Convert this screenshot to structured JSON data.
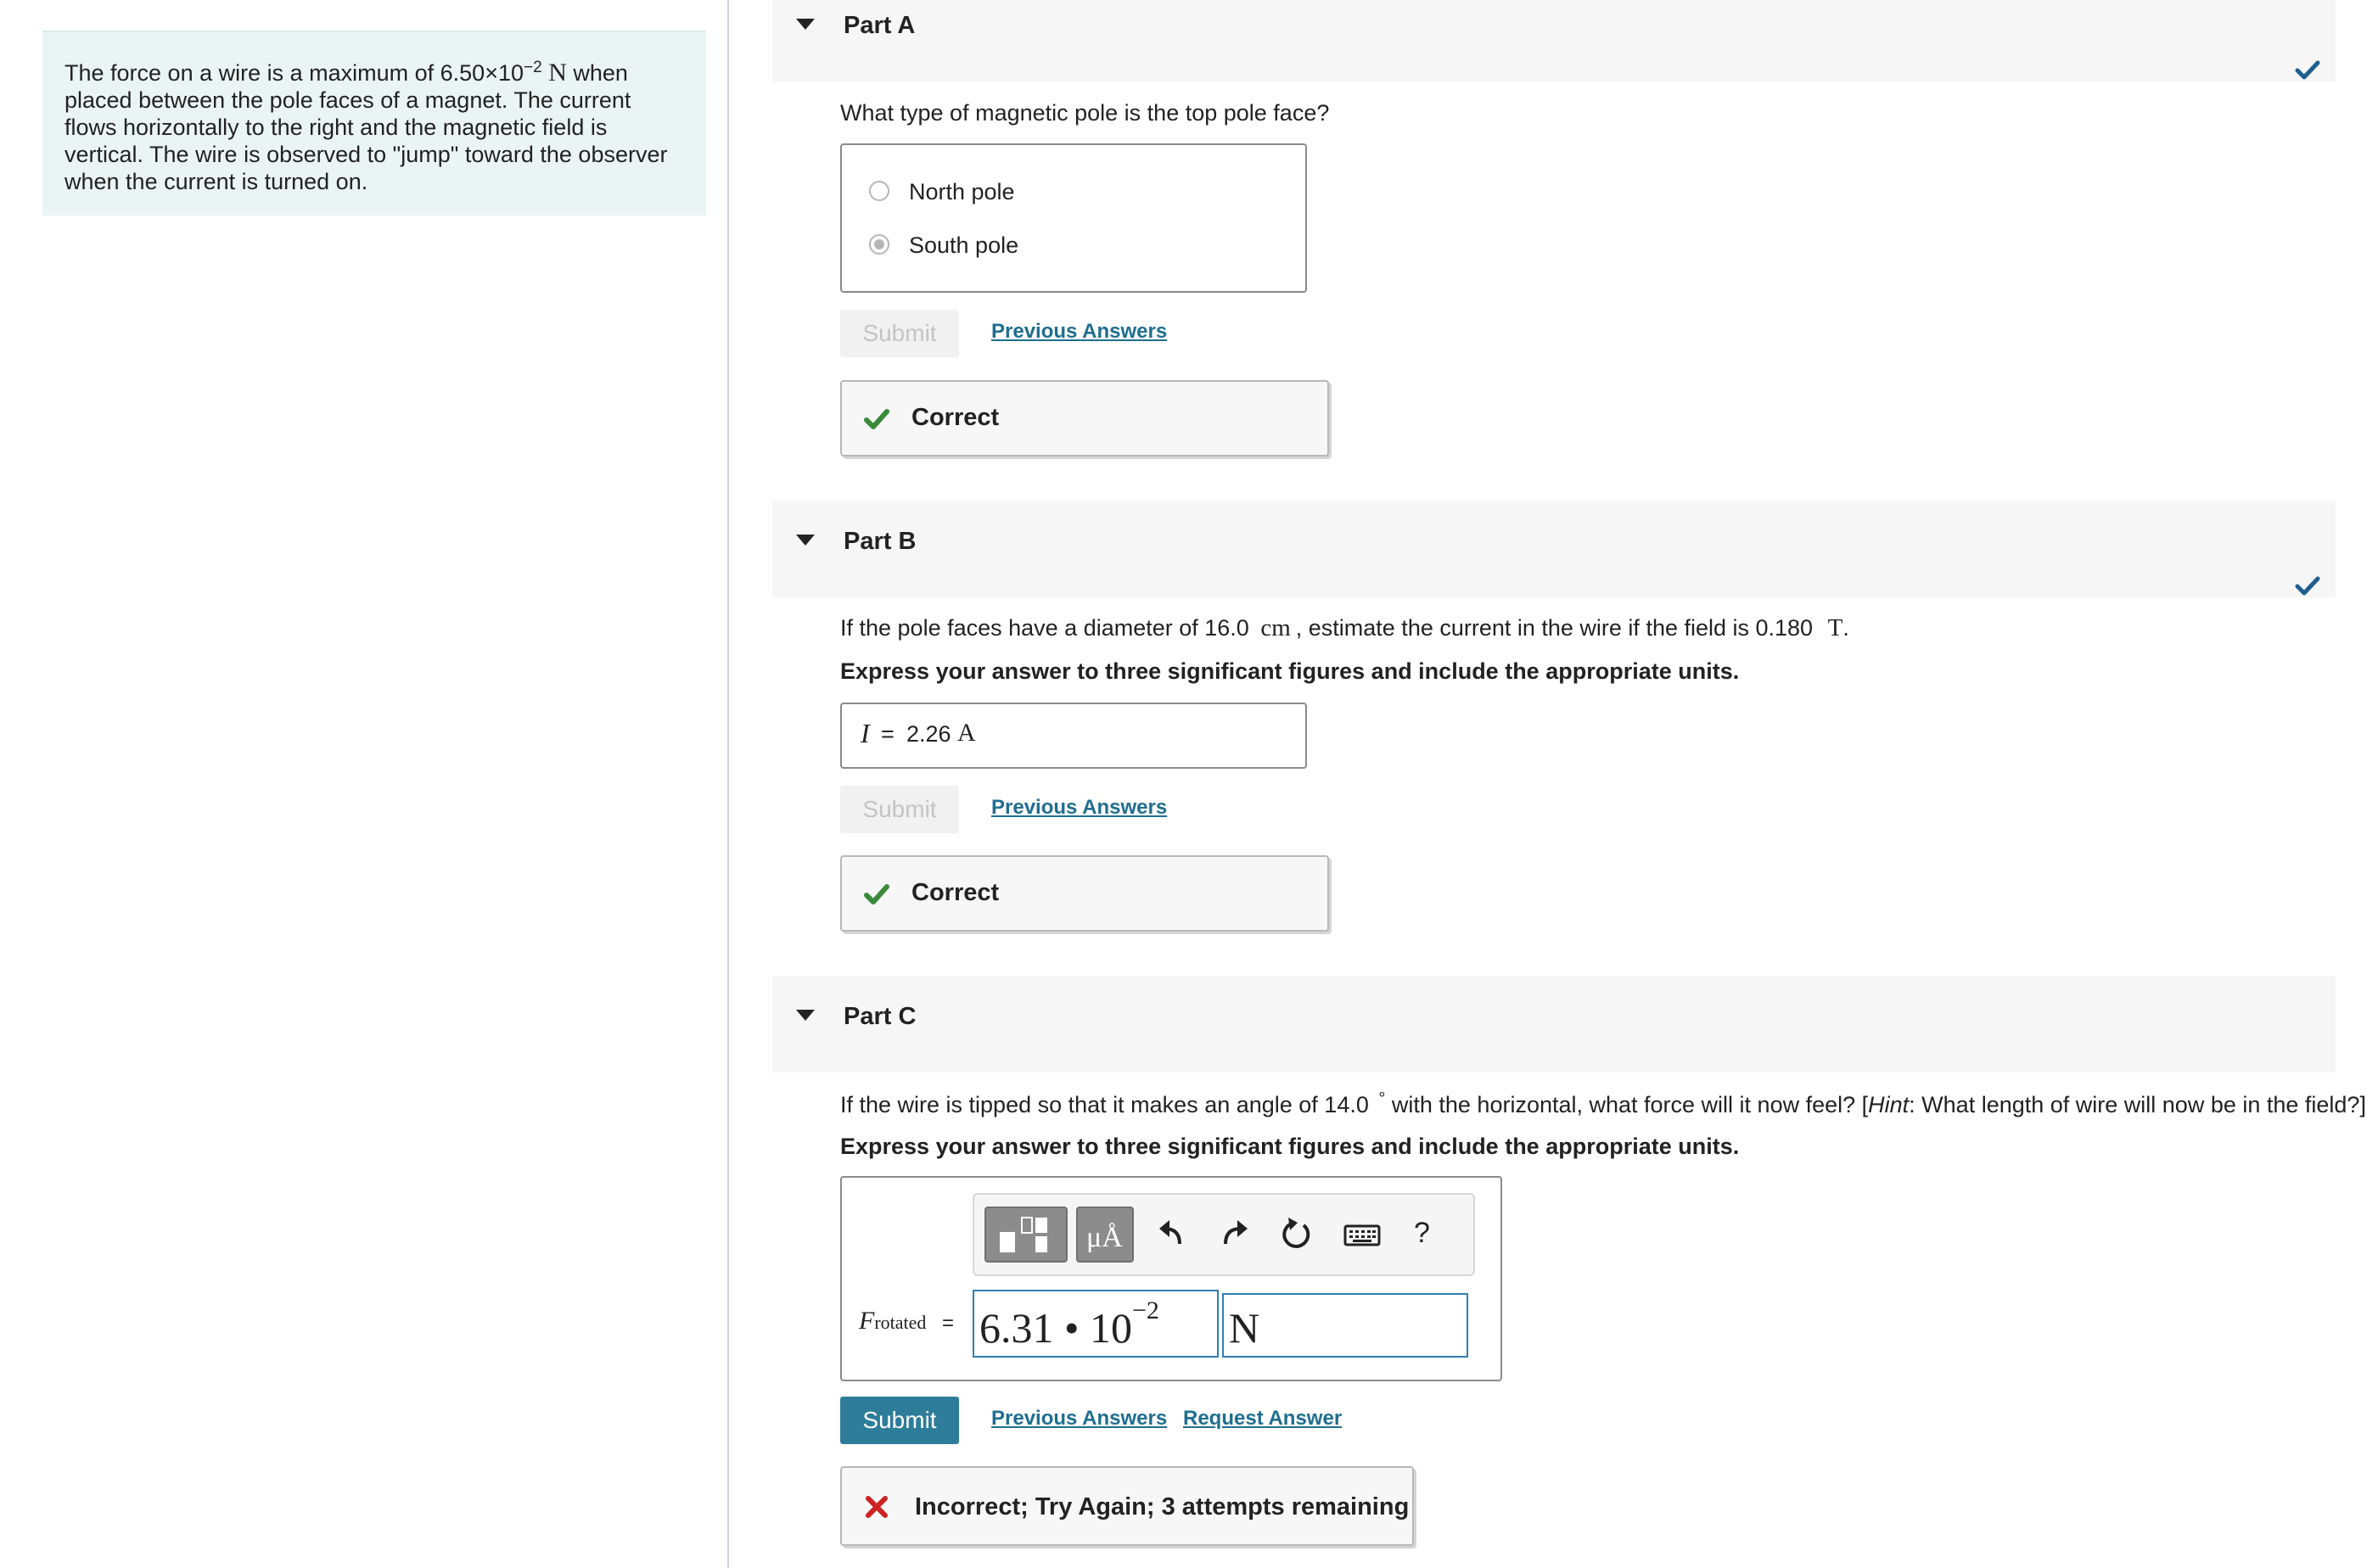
{
  "problem": {
    "text_before": "The force on a wire is a maximum of 6.50×10",
    "exponent": "−2",
    "unit": "N",
    "text_after": " when placed between the pole faces of a magnet. The current flows horizontally to the right and the magnetic field is vertical. The wire is observed to \"jump\" toward the observer when the current is turned on."
  },
  "part_a": {
    "title": "Part A",
    "question": "What type of magnetic pole is the top pole face?",
    "options": [
      {
        "label": "North pole",
        "selected": false
      },
      {
        "label": "South pole",
        "selected": true
      }
    ],
    "submit_label": "Submit",
    "previous_answers": "Previous Answers",
    "feedback": "Correct"
  },
  "part_b": {
    "title": "Part B",
    "question_1": "If the pole faces have a diameter of 16.0",
    "unit_cm": "cm",
    "question_2": ", estimate the current in the wire if the field is 0.180",
    "unit_t": "T",
    "question_3": ".",
    "instruction": "Express your answer to three significant figures and include the appropriate units.",
    "answer_var": "I",
    "answer_eq": "=",
    "answer_value": "2.26",
    "answer_unit": "A",
    "submit_label": "Submit",
    "previous_answers": "Previous Answers",
    "feedback": "Correct"
  },
  "part_c": {
    "title": "Part C",
    "question_1": "If the wire is tipped so that it makes an angle of 14.0",
    "degree": "°",
    "question_2": " with the horizontal, what force will it now feel? [",
    "hint_label": "Hint",
    "question_3": ": What length of wire will now be in the field?]",
    "instruction": "Express your answer to three significant figures and include the appropriate units.",
    "toolbar": {
      "units_label": "μÅ",
      "help_label": "?",
      "icons": [
        "templates-icon",
        "units-icon",
        "undo-icon",
        "redo-icon",
        "reset-icon",
        "keyboard-icon",
        "help-icon"
      ]
    },
    "var_main": "F",
    "var_sub": "rotated",
    "var_eq": "=",
    "value_mantissa": "6.31 • 10",
    "value_exponent": "−2",
    "value_unit": "N",
    "submit_label": "Submit",
    "previous_answers": "Previous Answers",
    "request_answer": "Request Answer",
    "feedback": "Incorrect; Try Again; 3 attempts remaining"
  },
  "colors": {
    "accent": "#2d7d9a",
    "link": "#1f6e90",
    "correct": "#3a8a3a",
    "incorrect": "#cc2222",
    "check": "#1f5f8f"
  }
}
